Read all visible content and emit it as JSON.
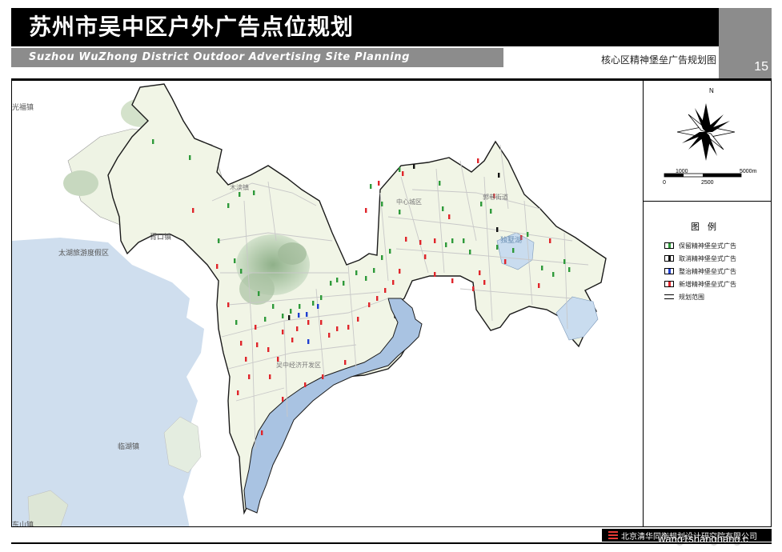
{
  "header": {
    "title": "苏州市吴中区户外广告点位规划",
    "subtitle": "Suzhou WuZhong District Outdoor Advertising Site Planning",
    "sheet_title": "核心区精神堡垒广告规划图",
    "page_number": "15"
  },
  "map": {
    "place_labels": {
      "guangfu": "光福镇",
      "xukou": "胥口镇",
      "taihu_resort": "太湖旅游度假区",
      "mudu": "木渎镇",
      "zhongxin": "中心城区",
      "guoxiang": "郭巷街道",
      "dushu_lake": "独墅湖",
      "wuzhong_econ": "吴中经济开发区",
      "linhu": "临湖镇",
      "dongshan": "东山镇"
    },
    "colors": {
      "lake": "#cfdeee",
      "lake_deep": "#a9c3e2",
      "land_fill": "#f1f5e6",
      "hill": "#b9cfb4",
      "road": "#c8c8c8",
      "boundary": "#1a1a1a"
    }
  },
  "compass": {
    "north": "N",
    "scale_top_left": "1000",
    "scale_top_right": "5000m",
    "scale_bottom_left": "0",
    "scale_bottom_mid": "2500"
  },
  "legend": {
    "title": "图例",
    "items": [
      {
        "label": "保留精神堡垒式广告",
        "color": "#2e9a3a",
        "kind": "bar"
      },
      {
        "label": "取消精神堡垒式广告",
        "color": "#111111",
        "kind": "bar"
      },
      {
        "label": "整治精神堡垒式广告",
        "color": "#1f3fd0",
        "kind": "bar"
      },
      {
        "label": "新增精神堡垒式广告",
        "color": "#e0252b",
        "kind": "bar"
      },
      {
        "label": "规划范围",
        "color": "#000000",
        "kind": "line"
      }
    ]
  },
  "markers": {
    "green": [
      [
        298,
        242
      ],
      [
        316,
        240
      ],
      [
        284,
        256
      ],
      [
        272,
        300
      ],
      [
        292,
        325
      ],
      [
        300,
        338
      ],
      [
        322,
        366
      ],
      [
        340,
        382
      ],
      [
        352,
        394
      ],
      [
        362,
        388
      ],
      [
        373,
        382
      ],
      [
        390,
        378
      ],
      [
        400,
        371
      ],
      [
        412,
        353
      ],
      [
        420,
        349
      ],
      [
        428,
        353
      ],
      [
        444,
        340
      ],
      [
        456,
        347
      ],
      [
        466,
        337
      ],
      [
        476,
        321
      ],
      [
        486,
        313
      ],
      [
        498,
        211
      ],
      [
        462,
        232
      ],
      [
        476,
        254
      ],
      [
        498,
        264
      ],
      [
        548,
        228
      ],
      [
        552,
        260
      ],
      [
        556,
        305
      ],
      [
        564,
        300
      ],
      [
        578,
        300
      ],
      [
        586,
        314
      ],
      [
        600,
        254
      ],
      [
        612,
        263
      ],
      [
        620,
        308
      ],
      [
        640,
        312
      ],
      [
        658,
        292
      ],
      [
        676,
        334
      ],
      [
        690,
        342
      ],
      [
        704,
        326
      ],
      [
        710,
        336
      ],
      [
        236,
        196
      ],
      [
        190,
        176
      ],
      [
        294,
        402
      ],
      [
        330,
        398
      ]
    ],
    "black": [
      [
        516,
        207
      ],
      [
        622,
        218
      ],
      [
        620,
        286
      ],
      [
        360,
        396
      ]
    ],
    "blue": [
      [
        372,
        393
      ],
      [
        382,
        392
      ],
      [
        396,
        382
      ],
      [
        384,
        426
      ]
    ],
    "red": [
      [
        240,
        262
      ],
      [
        270,
        332
      ],
      [
        284,
        380
      ],
      [
        300,
        428
      ],
      [
        306,
        448
      ],
      [
        320,
        430
      ],
      [
        334,
        436
      ],
      [
        352,
        414
      ],
      [
        370,
        410
      ],
      [
        384,
        402
      ],
      [
        400,
        402
      ],
      [
        410,
        418
      ],
      [
        420,
        410
      ],
      [
        434,
        408
      ],
      [
        446,
        398
      ],
      [
        460,
        380
      ],
      [
        470,
        372
      ],
      [
        480,
        362
      ],
      [
        490,
        352
      ],
      [
        498,
        338
      ],
      [
        456,
        262
      ],
      [
        472,
        228
      ],
      [
        502,
        216
      ],
      [
        506,
        298
      ],
      [
        524,
        302
      ],
      [
        530,
        320
      ],
      [
        542,
        300
      ],
      [
        560,
        270
      ],
      [
        596,
        200
      ],
      [
        616,
        244
      ],
      [
        630,
        326
      ],
      [
        650,
        296
      ],
      [
        672,
        356
      ],
      [
        686,
        300
      ],
      [
        598,
        340
      ],
      [
        604,
        352
      ],
      [
        326,
        540
      ],
      [
        310,
        470
      ],
      [
        296,
        490
      ],
      [
        402,
        470
      ],
      [
        430,
        452
      ],
      [
        380,
        480
      ],
      [
        336,
        470
      ],
      [
        352,
        498
      ],
      [
        318,
        408
      ],
      [
        364,
        424
      ],
      [
        346,
        448
      ],
      [
        542,
        342
      ],
      [
        564,
        350
      ],
      [
        590,
        360
      ]
    ]
  }
}
